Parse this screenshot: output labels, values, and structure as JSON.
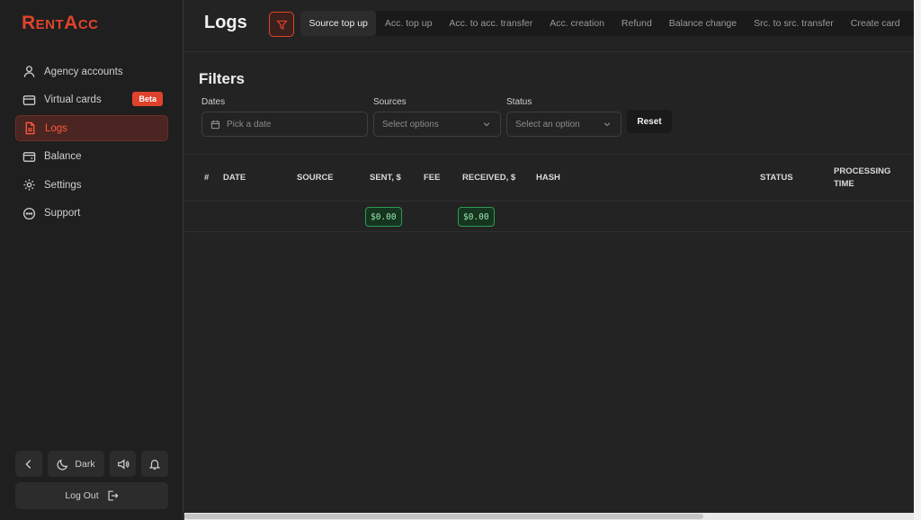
{
  "brand": {
    "logo": "RentAcc",
    "accent": "#e0432b"
  },
  "sidebar": {
    "items": [
      {
        "label": "Agency accounts",
        "icon": "user-icon"
      },
      {
        "label": "Virtual cards",
        "icon": "credit-card-icon",
        "badge": "Beta"
      },
      {
        "label": "Logs",
        "icon": "document-icon",
        "active": true
      },
      {
        "label": "Balance",
        "icon": "wallet-icon"
      },
      {
        "label": "Settings",
        "icon": "gear-icon"
      },
      {
        "label": "Support",
        "icon": "chat-icon"
      }
    ],
    "theme_label": "Dark",
    "logout_label": "Log Out"
  },
  "header": {
    "title": "Logs",
    "tabs": [
      {
        "label": "Source top up",
        "active": true
      },
      {
        "label": "Acc. top up"
      },
      {
        "label": "Acc. to acc. transfer"
      },
      {
        "label": "Acc. creation"
      },
      {
        "label": "Refund"
      },
      {
        "label": "Balance change"
      },
      {
        "label": "Src. to src. transfer"
      },
      {
        "label": "Create card"
      }
    ]
  },
  "filters": {
    "title": "Filters",
    "dates": {
      "label": "Dates",
      "placeholder": "Pick a date"
    },
    "sources": {
      "label": "Sources",
      "placeholder": "Select options"
    },
    "status": {
      "label": "Status",
      "placeholder": "Select an option"
    },
    "reset_label": "Reset"
  },
  "table": {
    "columns": [
      "#",
      "DATE",
      "SOURCE",
      "SENT, $",
      "FEE",
      "RECEIVED, $",
      "HASH",
      "STATUS",
      "PROCESSING",
      "TIME"
    ],
    "rows": [
      {
        "sent": "$0.00",
        "received": "$0.00"
      }
    ]
  }
}
